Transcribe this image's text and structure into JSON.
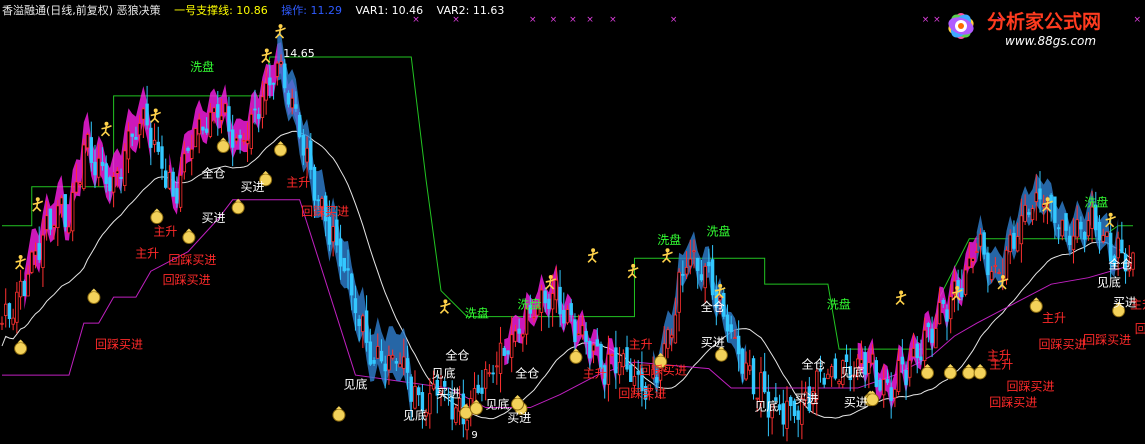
{
  "header": {
    "title": "香溢融通(日线,前复权) 恶狼决策",
    "items": [
      {
        "label": "一号支撑线: 10.86",
        "color": "#ffff00"
      },
      {
        "label": "操作: 11.29",
        "color": "#2f5bff"
      },
      {
        "label": "VAR1: 10.46",
        "color": "#ffffff"
      },
      {
        "label": "VAR2: 11.63",
        "color": "#ffffff"
      }
    ]
  },
  "logo": {
    "name": "分析家公式网",
    "url": "www.88gs.com"
  },
  "chart_data": {
    "type": "candlestick",
    "high_label": "14.65",
    "low_label": "9",
    "ylim": [
      8.6,
      15.1
    ],
    "n": 170,
    "key_closes": [
      [
        0,
        10.4
      ],
      [
        5,
        10.9
      ],
      [
        10,
        11.6
      ],
      [
        15,
        12.2
      ],
      [
        18,
        12.0
      ],
      [
        22,
        13.1
      ],
      [
        26,
        12.8
      ],
      [
        30,
        12.5
      ],
      [
        34,
        13.2
      ],
      [
        38,
        13.6
      ],
      [
        42,
        13.0
      ],
      [
        46,
        12.3
      ],
      [
        52,
        13.4
      ],
      [
        58,
        13.7
      ],
      [
        64,
        13.1
      ],
      [
        70,
        13.9
      ],
      [
        74,
        14.3
      ],
      [
        80,
        13.4
      ],
      [
        86,
        12.1
      ],
      [
        92,
        11.3
      ],
      [
        96,
        10.4
      ],
      [
        100,
        9.8
      ],
      [
        106,
        9.9
      ],
      [
        112,
        9.2
      ],
      [
        118,
        9.4
      ],
      [
        124,
        9.0
      ],
      [
        130,
        9.6
      ],
      [
        136,
        10.1
      ],
      [
        142,
        10.5
      ],
      [
        148,
        10.9
      ],
      [
        156,
        10.2
      ],
      [
        162,
        9.7
      ],
      [
        166,
        9.8
      ],
      [
        170,
        9.5
      ],
      [
        174,
        9.3
      ],
      [
        178,
        9.9
      ],
      [
        184,
        11.4
      ],
      [
        190,
        11.1
      ],
      [
        196,
        10.2
      ],
      [
        202,
        9.5
      ],
      [
        208,
        9.1
      ],
      [
        214,
        9.0
      ],
      [
        220,
        9.6
      ],
      [
        226,
        9.7
      ],
      [
        232,
        9.8
      ],
      [
        238,
        9.4
      ],
      [
        244,
        9.8
      ],
      [
        250,
        10.3
      ],
      [
        256,
        10.8
      ],
      [
        262,
        11.6
      ],
      [
        268,
        11.1
      ],
      [
        274,
        12.0
      ],
      [
        280,
        12.4
      ],
      [
        286,
        11.7
      ],
      [
        292,
        12.0
      ],
      [
        298,
        11.5
      ],
      [
        304,
        11.4
      ]
    ],
    "signals": [
      {
        "text": "洗盘",
        "color": "#33ff33",
        "x": 0.166,
        "y": 0.16
      },
      {
        "text": "洗盘",
        "color": "#33ff33",
        "x": 0.406,
        "y": 0.715
      },
      {
        "text": "洗盘",
        "color": "#33ff33",
        "x": 0.452,
        "y": 0.695
      },
      {
        "text": "洗盘",
        "color": "#33ff33",
        "x": 0.574,
        "y": 0.55
      },
      {
        "text": "洗盘",
        "color": "#33ff33",
        "x": 0.617,
        "y": 0.53
      },
      {
        "text": "洗盘",
        "color": "#33ff33",
        "x": 0.722,
        "y": 0.695
      },
      {
        "text": "洗盘",
        "color": "#33ff33",
        "x": 0.947,
        "y": 0.465
      },
      {
        "text": "全仓",
        "color": "#ffffff",
        "x": 0.176,
        "y": 0.4
      },
      {
        "text": "全仓",
        "color": "#ffffff",
        "x": 0.389,
        "y": 0.81
      },
      {
        "text": "全仓",
        "color": "#ffffff",
        "x": 0.45,
        "y": 0.85
      },
      {
        "text": "全仓",
        "color": "#ffffff",
        "x": 0.612,
        "y": 0.7
      },
      {
        "text": "全仓",
        "color": "#ffffff",
        "x": 0.7,
        "y": 0.83
      },
      {
        "text": "全仓",
        "color": "#ffffff",
        "x": 0.968,
        "y": 0.605
      },
      {
        "text": "买进",
        "color": "#ffffff",
        "x": 0.21,
        "y": 0.43
      },
      {
        "text": "买进",
        "color": "#ffffff",
        "x": 0.176,
        "y": 0.5
      },
      {
        "text": "买进",
        "color": "#ffffff",
        "x": 0.381,
        "y": 0.895
      },
      {
        "text": "买进",
        "color": "#ffffff",
        "x": 0.443,
        "y": 0.95
      },
      {
        "text": "买进",
        "color": "#ffffff",
        "x": 0.694,
        "y": 0.908
      },
      {
        "text": "买进",
        "color": "#ffffff",
        "x": 0.737,
        "y": 0.915
      },
      {
        "text": "买进",
        "color": "#ffffff",
        "x": 0.972,
        "y": 0.69
      },
      {
        "text": "买进",
        "color": "#ffffff",
        "x": 0.612,
        "y": 0.78
      },
      {
        "text": "见底",
        "color": "#ffffff",
        "x": 0.3,
        "y": 0.875
      },
      {
        "text": "见底",
        "color": "#ffffff",
        "x": 0.377,
        "y": 0.85
      },
      {
        "text": "见底",
        "color": "#ffffff",
        "x": 0.352,
        "y": 0.945
      },
      {
        "text": "见底",
        "color": "#ffffff",
        "x": 0.424,
        "y": 0.92
      },
      {
        "text": "见底",
        "color": "#ffffff",
        "x": 0.659,
        "y": 0.925
      },
      {
        "text": "见底",
        "color": "#ffffff",
        "x": 0.734,
        "y": 0.848
      },
      {
        "text": "见底",
        "color": "#ffffff",
        "x": 0.958,
        "y": 0.645
      },
      {
        "text": "主升",
        "color": "#ff2a2a",
        "x": 0.25,
        "y": 0.42
      },
      {
        "text": "主升",
        "color": "#ff2a2a",
        "x": 0.134,
        "y": 0.53
      },
      {
        "text": "主升",
        "color": "#ff2a2a",
        "x": 0.118,
        "y": 0.58
      },
      {
        "text": "主升",
        "color": "#ff2a2a",
        "x": 0.549,
        "y": 0.785
      },
      {
        "text": "主升",
        "color": "#ff2a2a",
        "x": 0.509,
        "y": 0.85
      },
      {
        "text": "主升",
        "color": "#ff2a2a",
        "x": 0.864,
        "y": 0.83
      },
      {
        "text": "主升",
        "color": "#ff2a2a",
        "x": 0.91,
        "y": 0.725
      },
      {
        "text": "主升",
        "color": "#ff2a2a",
        "x": 0.862,
        "y": 0.81
      },
      {
        "text": "主升",
        "color": "#ff2a2a",
        "x": 0.987,
        "y": 0.695
      },
      {
        "text": "回踩买进",
        "color": "#ff2a2a",
        "x": 0.147,
        "y": 0.595
      },
      {
        "text": "回踩买进",
        "color": "#ff2a2a",
        "x": 0.142,
        "y": 0.64
      },
      {
        "text": "回踩买进",
        "color": "#ff2a2a",
        "x": 0.263,
        "y": 0.485
      },
      {
        "text": "回踩买进",
        "color": "#ff2a2a",
        "x": 0.083,
        "y": 0.785
      },
      {
        "text": "回踩买进",
        "color": "#ff2a2a",
        "x": 0.558,
        "y": 0.843
      },
      {
        "text": "回踩买进",
        "color": "#ff2a2a",
        "x": 0.54,
        "y": 0.895
      },
      {
        "text": "回踩买进",
        "color": "#ff2a2a",
        "x": 0.907,
        "y": 0.785
      },
      {
        "text": "回踩买进",
        "color": "#ff2a2a",
        "x": 0.946,
        "y": 0.775
      },
      {
        "text": "回踩买进",
        "color": "#ff2a2a",
        "x": 0.879,
        "y": 0.88
      },
      {
        "text": "回踩买进",
        "color": "#ff2a2a",
        "x": 0.864,
        "y": 0.915
      },
      {
        "text": "回踩买进",
        "color": "#ff2a2a",
        "x": 0.991,
        "y": 0.75
      }
    ],
    "bags": [
      [
        0.018,
        0.785
      ],
      [
        0.082,
        0.67
      ],
      [
        0.137,
        0.49
      ],
      [
        0.165,
        0.535
      ],
      [
        0.208,
        0.468
      ],
      [
        0.232,
        0.405
      ],
      [
        0.245,
        0.338
      ],
      [
        0.195,
        0.33
      ],
      [
        0.296,
        0.935
      ],
      [
        0.407,
        0.93
      ],
      [
        0.455,
        0.92
      ],
      [
        0.503,
        0.805
      ],
      [
        0.577,
        0.815
      ],
      [
        0.63,
        0.8
      ],
      [
        0.452,
        0.91
      ],
      [
        0.76,
        0.9
      ],
      [
        0.83,
        0.84
      ],
      [
        0.846,
        0.84
      ],
      [
        0.856,
        0.84
      ],
      [
        0.905,
        0.69
      ],
      [
        0.977,
        0.7
      ],
      [
        0.762,
        0.9
      ],
      [
        0.81,
        0.84
      ],
      [
        0.416,
        0.92
      ]
    ],
    "people": [
      [
        0.018,
        0.59
      ],
      [
        0.033,
        0.46
      ],
      [
        0.093,
        0.29
      ],
      [
        0.136,
        0.26
      ],
      [
        0.233,
        0.125
      ],
      [
        0.245,
        0.07
      ],
      [
        0.389,
        0.69
      ],
      [
        0.481,
        0.635
      ],
      [
        0.518,
        0.575
      ],
      [
        0.553,
        0.61
      ],
      [
        0.583,
        0.575
      ],
      [
        0.629,
        0.655
      ],
      [
        0.787,
        0.67
      ],
      [
        0.836,
        0.66
      ],
      [
        0.876,
        0.635
      ],
      [
        0.915,
        0.46
      ],
      [
        0.97,
        0.495
      ]
    ],
    "xmarks": [
      0.36,
      0.395,
      0.462,
      0.48,
      0.497,
      0.512,
      0.532,
      0.585,
      0.805,
      0.815,
      0.87,
      0.99
    ]
  }
}
